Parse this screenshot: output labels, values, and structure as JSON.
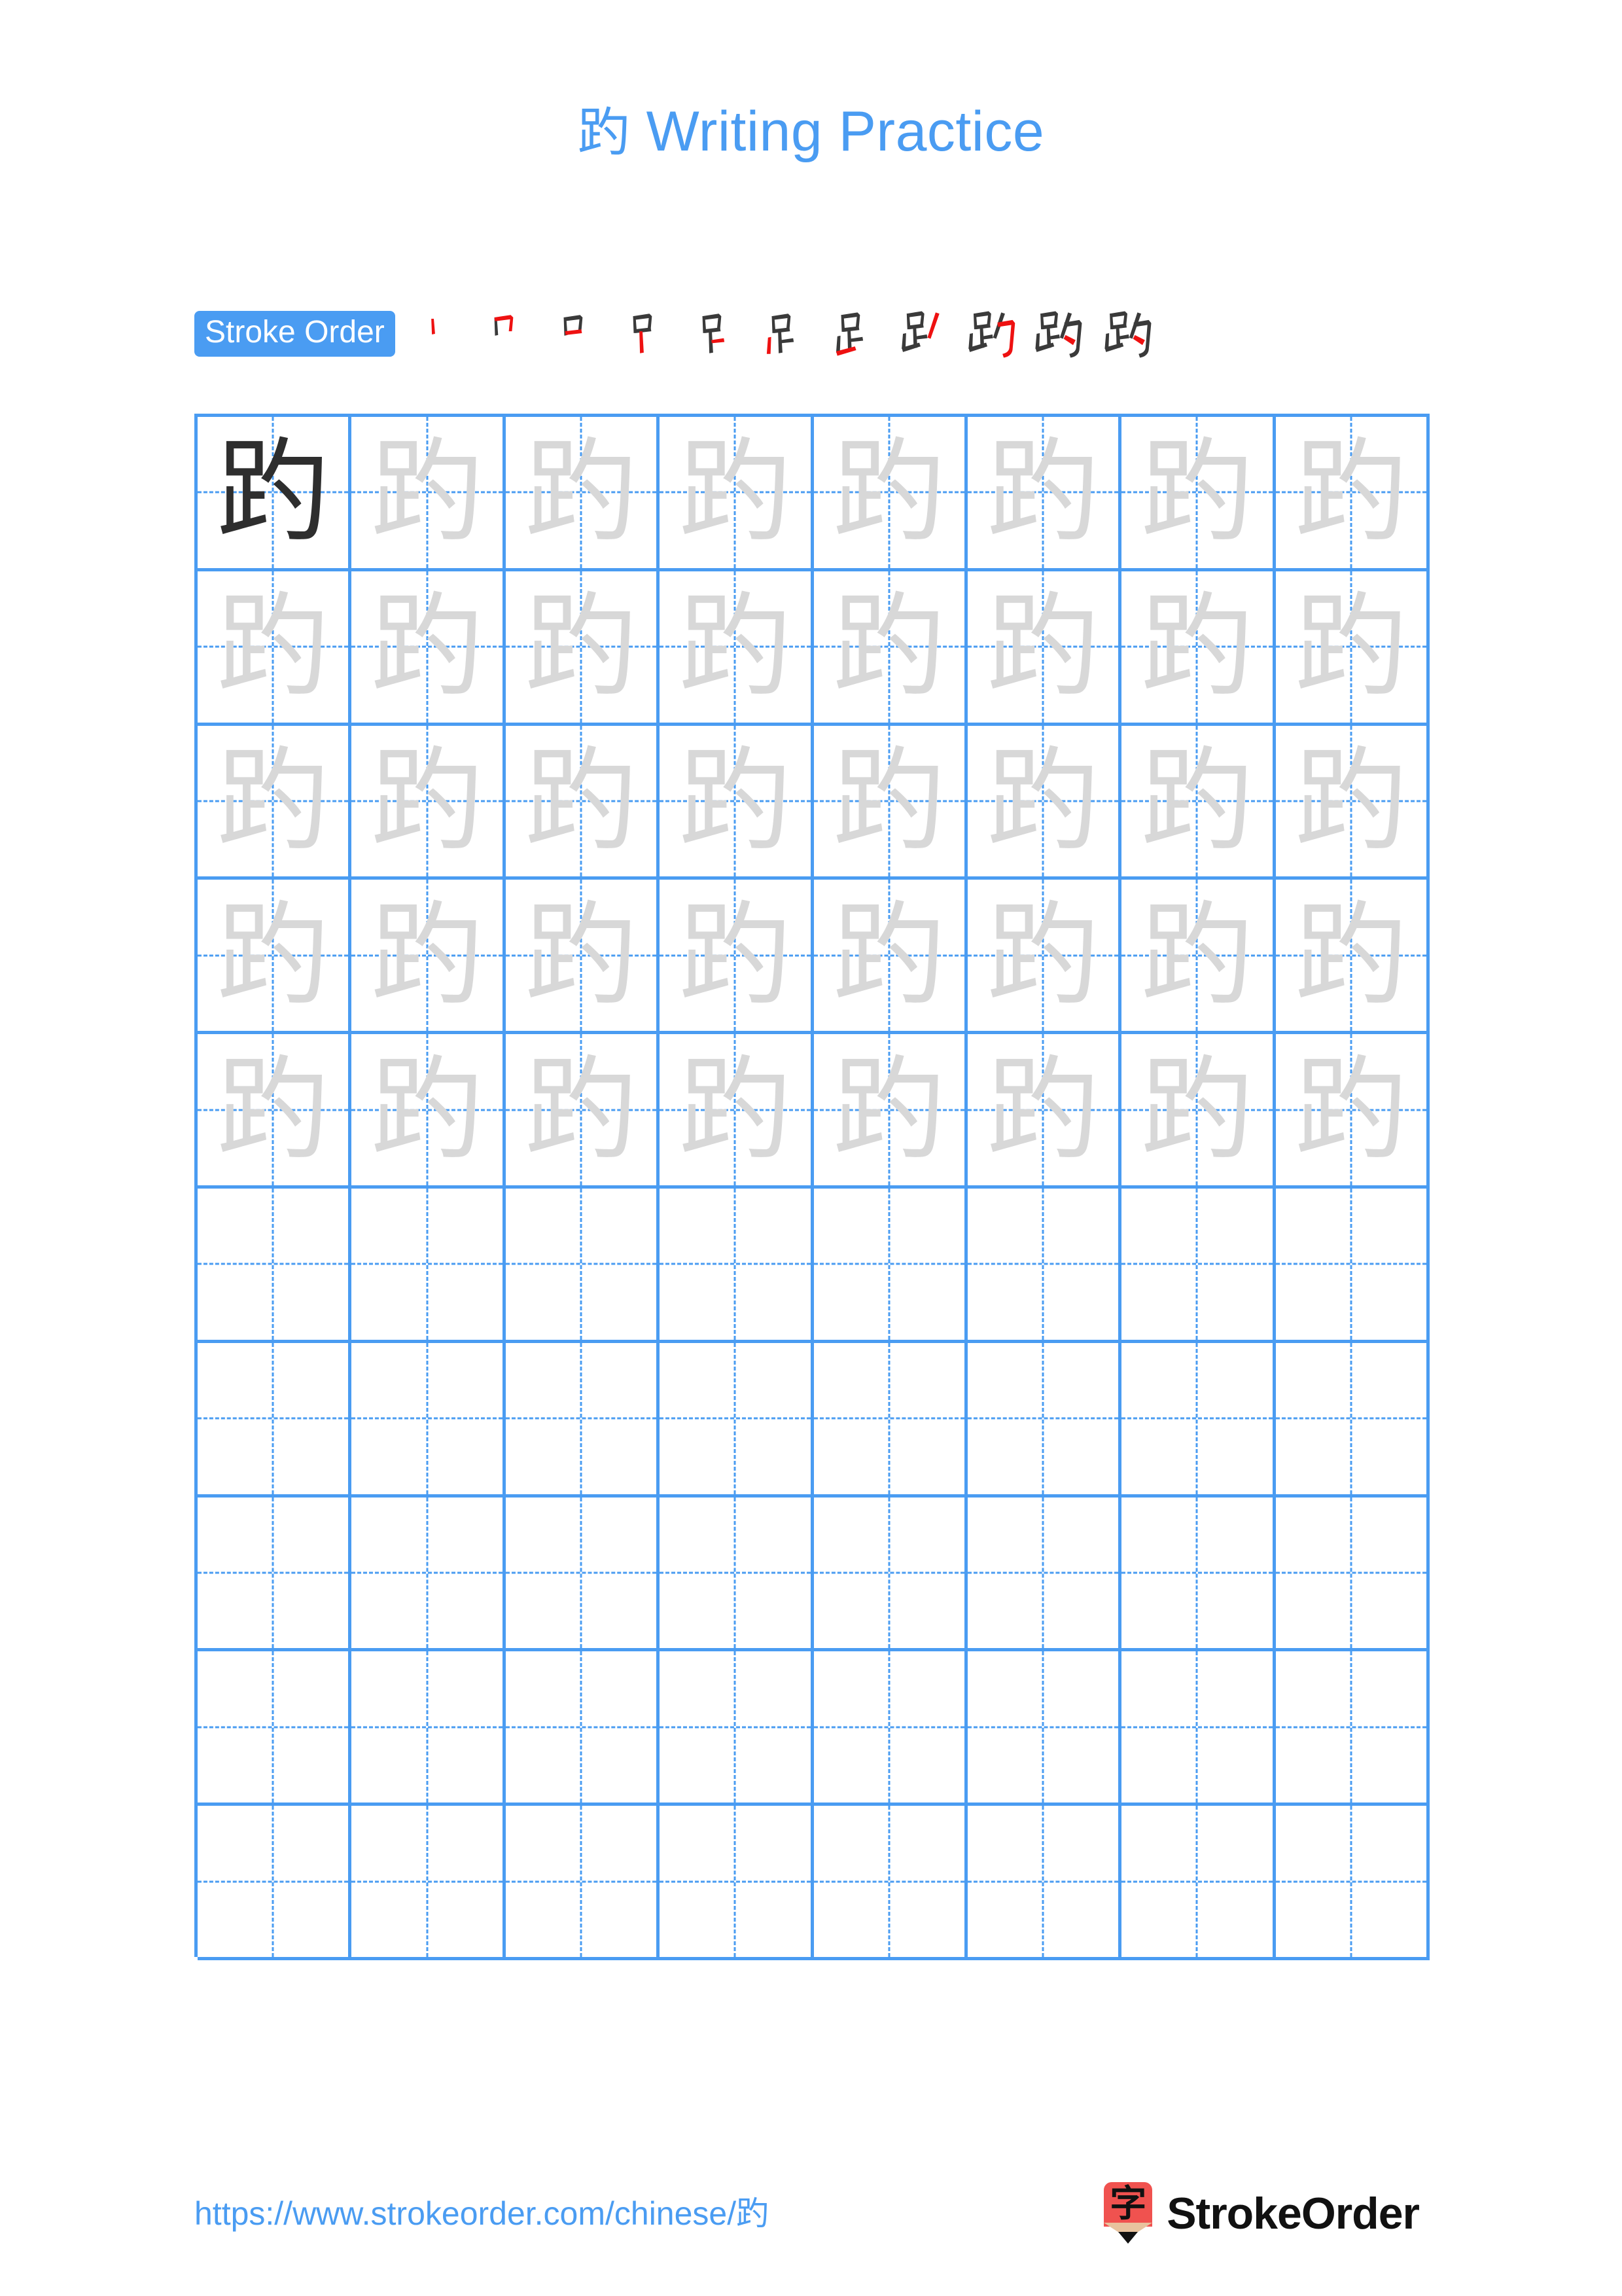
{
  "character": "趵",
  "title": {
    "char": "趵",
    "suffix": " Writing Practice",
    "color": "#4a9cf2"
  },
  "stroke_order": {
    "label": "Stroke Order",
    "badge_color": "#4a9cf2",
    "badge_text_color": "#ffffff",
    "existing_stroke_color": "#3a3a3a",
    "new_stroke_color": "#ee1111",
    "total_strokes": 11,
    "steps": [
      {
        "index": 1,
        "new_stroke": "vertical"
      },
      {
        "index": 2,
        "new_stroke": "horizontal-fold"
      },
      {
        "index": 3,
        "new_stroke": "horizontal"
      },
      {
        "index": 4,
        "new_stroke": "vertical"
      },
      {
        "index": 5,
        "new_stroke": "horizontal"
      },
      {
        "index": 6,
        "new_stroke": "vertical-left"
      },
      {
        "index": 7,
        "new_stroke": "horizontal-rising"
      },
      {
        "index": 8,
        "new_stroke": "slanting-right"
      },
      {
        "index": 9,
        "new_stroke": "horizontal-fold-hook"
      },
      {
        "index": 10,
        "new_stroke": "dot"
      },
      {
        "index": 11,
        "new_stroke": "final"
      }
    ]
  },
  "grid": {
    "columns": 8,
    "rows": 10,
    "line_color": "#4a9cf2",
    "guide_color": "#4a9cf2",
    "model_char_color": "#2e2e2e",
    "trace_char_color": "#d8d8d8",
    "rows_data": [
      {
        "row": 1,
        "cells": [
          "dark",
          "trace",
          "trace",
          "trace",
          "trace",
          "trace",
          "trace",
          "trace"
        ]
      },
      {
        "row": 2,
        "cells": [
          "trace",
          "trace",
          "trace",
          "trace",
          "trace",
          "trace",
          "trace",
          "trace"
        ]
      },
      {
        "row": 3,
        "cells": [
          "trace",
          "trace",
          "trace",
          "trace",
          "trace",
          "trace",
          "trace",
          "trace"
        ]
      },
      {
        "row": 4,
        "cells": [
          "trace",
          "trace",
          "trace",
          "trace",
          "trace",
          "trace",
          "trace",
          "trace"
        ]
      },
      {
        "row": 5,
        "cells": [
          "trace",
          "trace",
          "trace",
          "trace",
          "trace",
          "trace",
          "trace",
          "trace"
        ]
      },
      {
        "row": 6,
        "cells": [
          "blank",
          "blank",
          "blank",
          "blank",
          "blank",
          "blank",
          "blank",
          "blank"
        ]
      },
      {
        "row": 7,
        "cells": [
          "blank",
          "blank",
          "blank",
          "blank",
          "blank",
          "blank",
          "blank",
          "blank"
        ]
      },
      {
        "row": 8,
        "cells": [
          "blank",
          "blank",
          "blank",
          "blank",
          "blank",
          "blank",
          "blank",
          "blank"
        ]
      },
      {
        "row": 9,
        "cells": [
          "blank",
          "blank",
          "blank",
          "blank",
          "blank",
          "blank",
          "blank",
          "blank"
        ]
      },
      {
        "row": 10,
        "cells": [
          "blank",
          "blank",
          "blank",
          "blank",
          "blank",
          "blank",
          "blank",
          "blank"
        ]
      }
    ]
  },
  "footer": {
    "url_prefix": "https://www.strokeorder.com/chinese/",
    "url_char": "趵",
    "url_color": "#4a9cf2",
    "brand_name": "StrokeOrder",
    "brand_mark_char": "字",
    "brand_mark_color": "#f0524f"
  }
}
